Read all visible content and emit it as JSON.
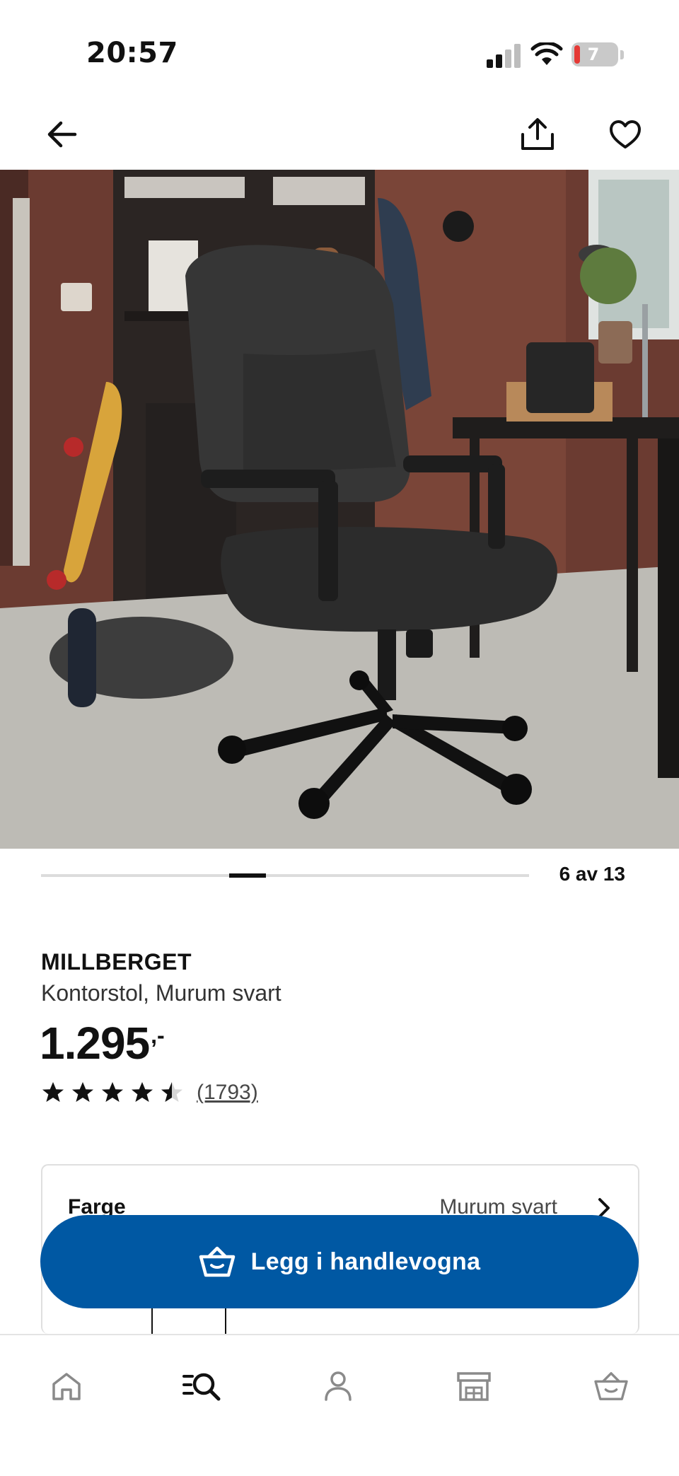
{
  "status_bar": {
    "time": "20:57",
    "battery_level": "7",
    "icons": [
      "signal-icon",
      "wifi-icon",
      "battery-icon"
    ]
  },
  "top_nav": {
    "icons": [
      "back-arrow-icon",
      "share-icon",
      "heart-icon"
    ]
  },
  "gallery": {
    "count_label": "6 av 13",
    "current": 6,
    "total": 13
  },
  "product": {
    "name": "MILLBERGET",
    "description": "Kontorstol, Murum svart",
    "price": "1.295",
    "price_suffix": ",-",
    "rating": 4.5,
    "rating_max": 5,
    "review_count": "(1793)"
  },
  "options": {
    "color_label": "Farge",
    "color_value": "Murum svart"
  },
  "cta": {
    "label": "Legg i handlevogna",
    "icon": "basket-icon",
    "color": "#0058a3"
  },
  "tab_bar": {
    "items": [
      "home-icon",
      "search-icon",
      "profile-icon",
      "store-icon",
      "basket-icon"
    ]
  }
}
